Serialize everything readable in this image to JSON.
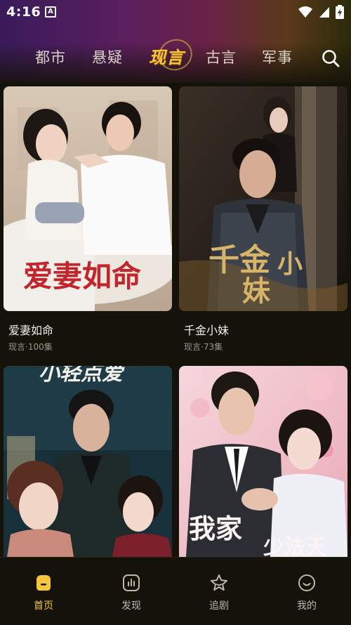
{
  "status_bar": {
    "time": "4:16",
    "notification_glyph": "A"
  },
  "tabs": [
    {
      "label": "都市",
      "active": false
    },
    {
      "label": "悬疑",
      "active": false
    },
    {
      "label": "现言",
      "active": true
    },
    {
      "label": "古言",
      "active": false
    },
    {
      "label": "军事",
      "active": false
    }
  ],
  "search": {
    "icon": "search-icon"
  },
  "dramas": [
    {
      "title": "爱妻如命",
      "meta": "现言·100集",
      "poster_text": "爱妻如命"
    },
    {
      "title": "千金小妹",
      "meta": "现言·73集",
      "poster_text_a": "千金",
      "poster_text_b": "小",
      "poster_text_c": "妹"
    },
    {
      "poster_text": "小轻点爱"
    },
    {
      "poster_text_a": "我家",
      "poster_text_b": "少法天"
    }
  ],
  "bottom_nav": [
    {
      "label": "首页",
      "icon": "home-icon",
      "active": true
    },
    {
      "label": "发现",
      "icon": "discover-icon",
      "active": false
    },
    {
      "label": "追剧",
      "icon": "star-icon",
      "active": false
    },
    {
      "label": "我的",
      "icon": "profile-icon",
      "active": false
    }
  ],
  "colors": {
    "accent": "#f5c53a",
    "background": "#141209",
    "text": "#f2efe6",
    "meta": "#9b968a"
  }
}
